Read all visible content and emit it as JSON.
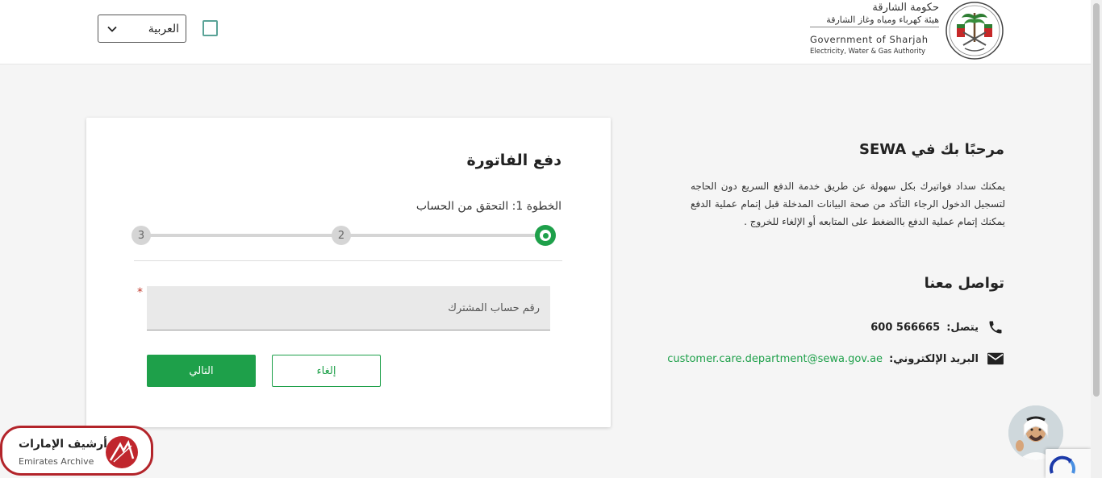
{
  "header": {
    "language_select": {
      "value": "العربية"
    },
    "logo": {
      "arabic_line1": "حكومة الشارقة",
      "arabic_line2": "هيئة كهرباء ومياه وغاز الشارقة",
      "english_line1": "Government of Sharjah",
      "english_line2": "Electricity, Water & Gas Authority"
    }
  },
  "card": {
    "title": "دفع الفاتورة",
    "step_title": "الخطوة 1: التحقق من الحساب",
    "steps": [
      "1",
      "2",
      "3"
    ],
    "active_step": 1,
    "required_mark": "*",
    "account_input_placeholder": "رقم حساب المشترك",
    "next_label": "التالي",
    "cancel_label": "إلغاء"
  },
  "info": {
    "welcome_title": "مرحبًا بك في SEWA",
    "welcome_text": "يمكنك سداد فواتيرك بكل سهولة عن طريق خدمة الدفع السريع دون الحاجه لتسجيل الدخول الرجاء التأكد من صحة البيانات المدخلة قبل إتمام عملية الدفع يمكنك إتمام عملية الدفع باالضغط على المتابعه أو الإلغاء للخروج .",
    "contact_title": "تواصل معنا",
    "phone_label": "يتصل:",
    "phone_value": "600 566665",
    "email_label": "البريد الإلكتروني:",
    "email_value": "customer.care.department@sewa.gov.ae"
  },
  "archive_badge": {
    "arabic": "أرشيف الإمارات",
    "english": "Emirates Archive"
  },
  "colors": {
    "primary_green": "#1ea04a",
    "archive_red": "#b3242a"
  },
  "icons": {
    "phone": "phone-icon",
    "email": "envelope-icon",
    "dropdown": "chevron-down-icon"
  }
}
